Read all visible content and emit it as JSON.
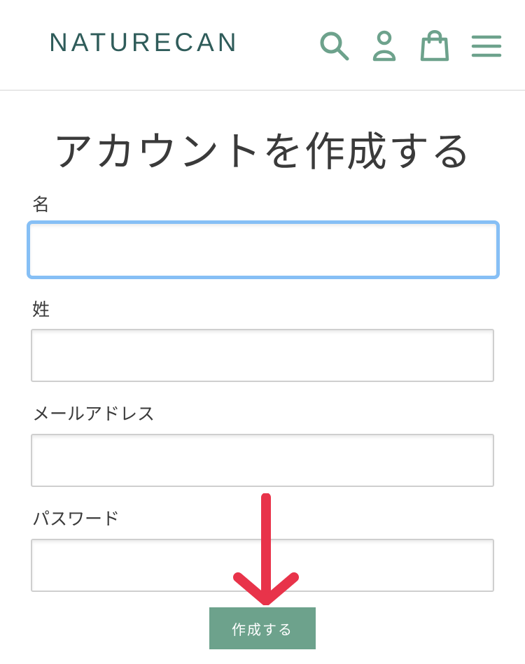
{
  "header": {
    "logo_text": "NATURECAN",
    "icons": [
      "search-icon",
      "account-icon",
      "cart-icon",
      "menu-icon"
    ],
    "icon_color": "#6da28c",
    "logo_color": "#2f5c5a"
  },
  "page": {
    "title": "アカウントを作成する"
  },
  "form": {
    "first_name": {
      "label": "名",
      "value": ""
    },
    "last_name": {
      "label": "姓",
      "value": ""
    },
    "email": {
      "label": "メールアドレス",
      "value": ""
    },
    "password": {
      "label": "パスワード",
      "value": ""
    },
    "submit_label": "作成する",
    "submit_color": "#6da28c",
    "focus_color": "#86bff5"
  },
  "annotation": {
    "arrow_color": "#e8334a"
  }
}
